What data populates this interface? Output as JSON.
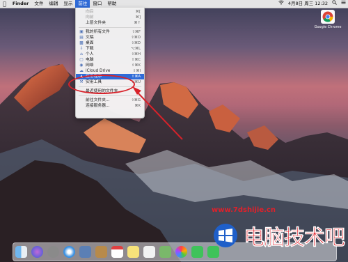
{
  "menubar": {
    "app": "Finder",
    "items": [
      "文件",
      "编辑",
      "显示",
      "前往",
      "窗口",
      "帮助"
    ],
    "active_index": 3,
    "datetime": "4月8日 周三 12:32"
  },
  "go_menu": [
    {
      "label": "向后",
      "shortcut": "⌘[",
      "icon": "",
      "state": "disabled"
    },
    {
      "label": "向前",
      "shortcut": "⌘]",
      "icon": "",
      "state": "disabled"
    },
    {
      "label": "上层文件夹",
      "shortcut": "⌘↑",
      "icon": "",
      "state": "normal"
    },
    {
      "separator": true
    },
    {
      "label": "我的所有文件",
      "shortcut": "⇧⌘F",
      "icon": "all-files-icon",
      "state": "normal"
    },
    {
      "label": "文稿",
      "shortcut": "⇧⌘O",
      "icon": "documents-icon",
      "state": "normal"
    },
    {
      "label": "桌面",
      "shortcut": "⇧⌘D",
      "icon": "desktop-icon",
      "state": "normal"
    },
    {
      "label": "下载",
      "shortcut": "⌥⌘L",
      "icon": "downloads-icon",
      "state": "normal"
    },
    {
      "label": "个人",
      "shortcut": "⇧⌘H",
      "icon": "home-icon",
      "state": "normal"
    },
    {
      "label": "电脑",
      "shortcut": "⇧⌘C",
      "icon": "computer-icon",
      "state": "normal"
    },
    {
      "label": "网络",
      "shortcut": "⇧⌘K",
      "icon": "network-icon",
      "state": "normal"
    },
    {
      "label": "iCloud Drive",
      "shortcut": "⇧⌘I",
      "icon": "icloud-icon",
      "state": "normal"
    },
    {
      "label": "应用程序",
      "shortcut": "⇧⌘A",
      "icon": "applications-icon",
      "state": "highlight"
    },
    {
      "label": "实用工具",
      "shortcut": "⇧⌘U",
      "icon": "utilities-icon",
      "state": "normal"
    },
    {
      "separator": true
    },
    {
      "label": "最近使用的文件夹",
      "shortcut": "",
      "icon": "",
      "state": "normal"
    },
    {
      "separator": true
    },
    {
      "label": "前往文件夹...",
      "shortcut": "⇧⌘G",
      "icon": "",
      "state": "normal"
    },
    {
      "label": "连接服务器...",
      "shortcut": "⌘K",
      "icon": "",
      "state": "normal"
    }
  ],
  "desktop_icon": {
    "label": "Google Chrome"
  },
  "watermark": {
    "url": "www.7dshijie.cn",
    "brand": "电脑技术吧"
  },
  "colors": {
    "accent": "#2f6bd8",
    "annotation": "#d8222a"
  }
}
